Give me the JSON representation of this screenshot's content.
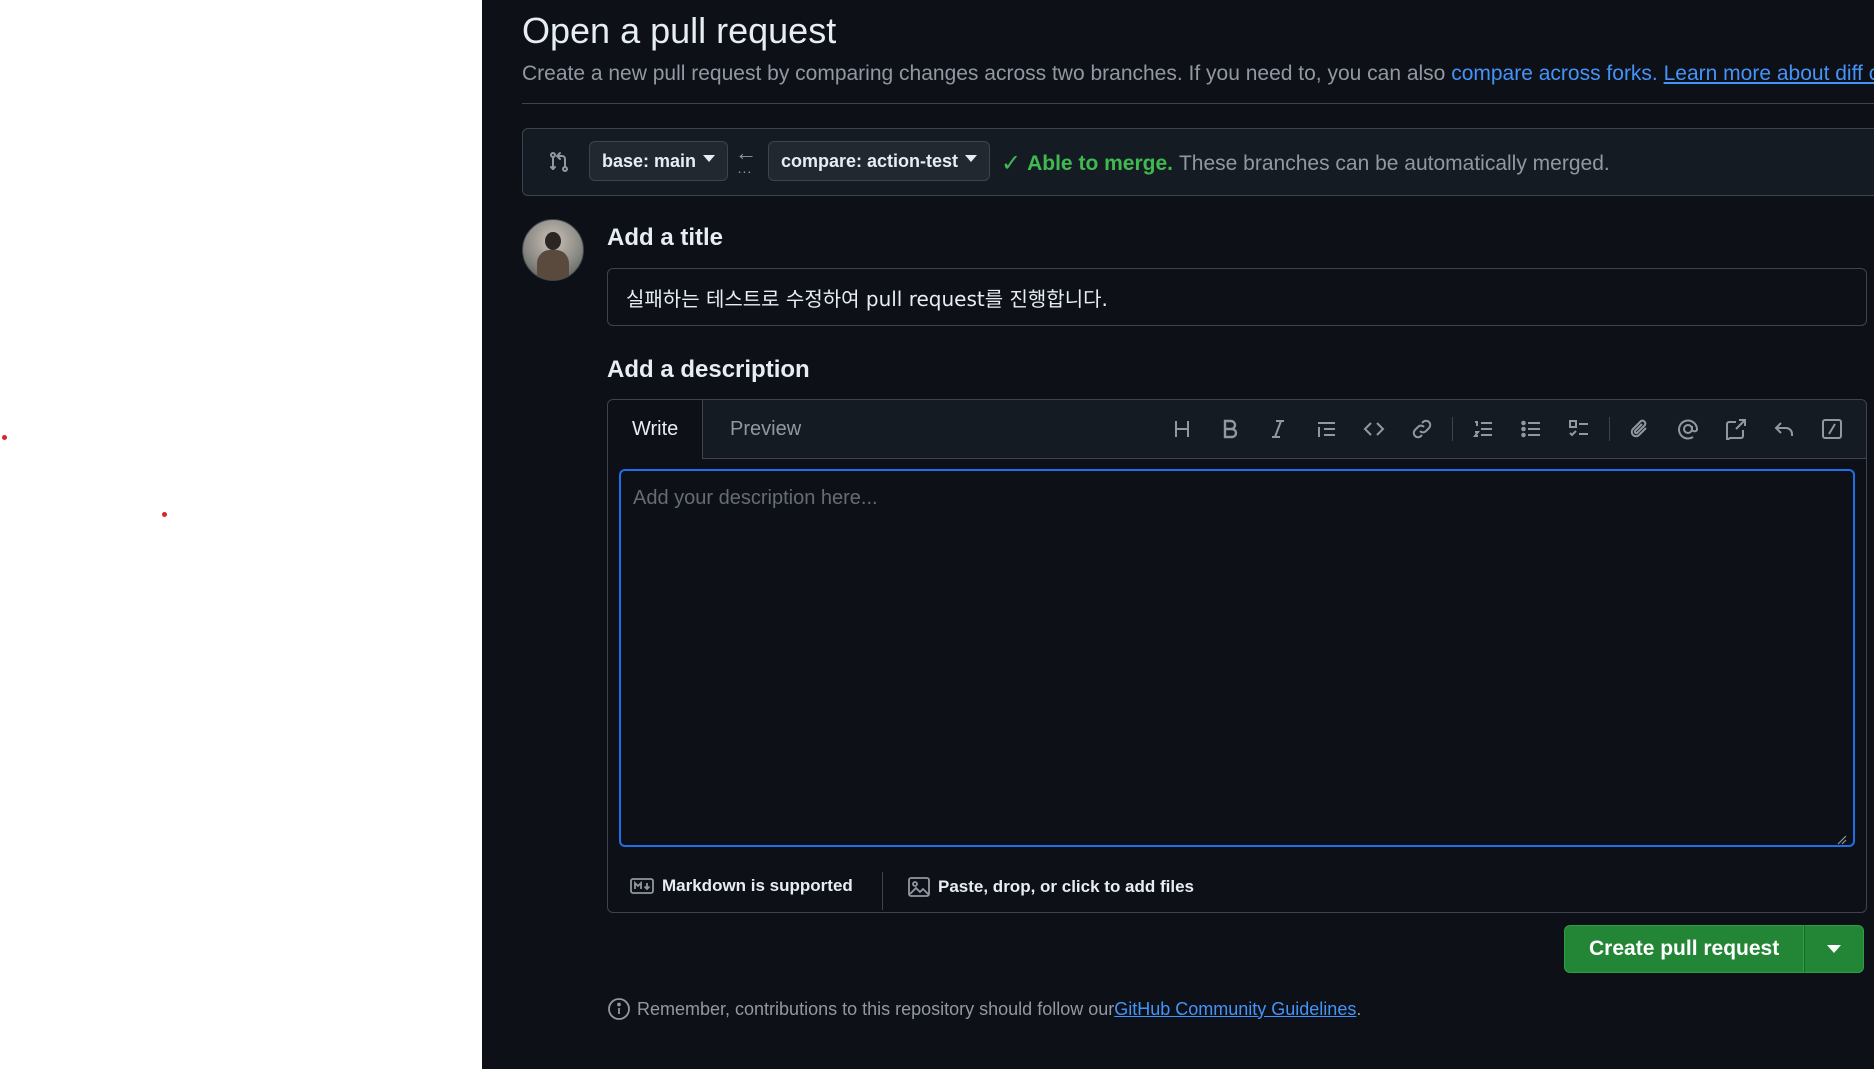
{
  "page": {
    "title": "Open a pull request",
    "subtitle_text": "Create a new pull request by comparing changes across two branches. If you need to, you can also ",
    "subtitle_link_forks": "compare across forks.",
    "subtitle_link_learn": "Learn more about diff co"
  },
  "range": {
    "base_label": "base: main",
    "compare_label": "compare: action-test",
    "arrow_dots": "...",
    "merge_ok": "Able to merge.",
    "merge_detail": "These branches can be automatically merged."
  },
  "form": {
    "title_heading": "Add a title",
    "title_value": "실패하는 테스트로 수정하여 pull request를 진행합니다.",
    "description_heading": "Add a description",
    "tab_write": "Write",
    "tab_preview": "Preview",
    "description_placeholder": "Add your description here...",
    "markdown_note": "Markdown is supported",
    "attach_note": "Paste, drop, or click to add files"
  },
  "toolbar_icons": [
    "heading-icon",
    "bold-icon",
    "italic-icon",
    "quote-icon",
    "code-icon",
    "link-icon",
    "ordered-list-icon",
    "unordered-list-icon",
    "task-list-icon",
    "attach-icon",
    "mention-icon",
    "cross-reference-icon",
    "reply-icon",
    "slash-command-icon"
  ],
  "actions": {
    "create_label": "Create pull request"
  },
  "footer": {
    "guidelines_text": "Remember, contributions to this repository should follow our ",
    "guidelines_link": "GitHub Community Guidelines",
    "guidelines_end": "."
  },
  "colors": {
    "background": "#0d1117",
    "accent_blue": "#1f6feb",
    "link_blue": "#4493f8",
    "success_green": "#3fb950",
    "button_green": "#238636"
  }
}
